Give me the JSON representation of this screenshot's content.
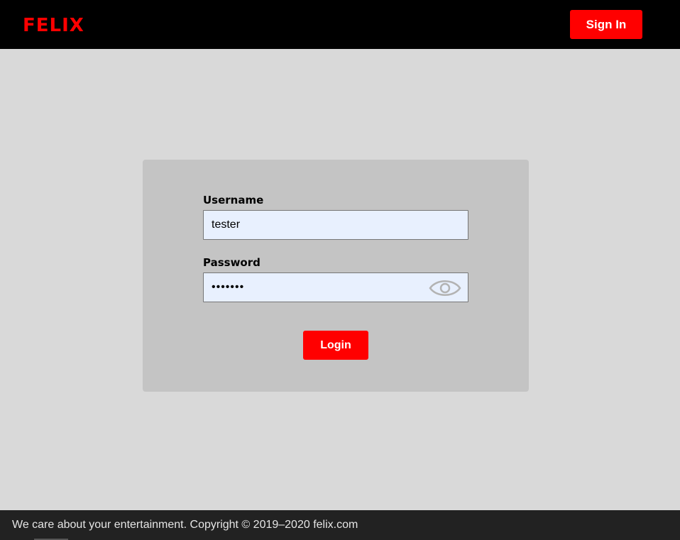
{
  "header": {
    "logo": "FELIX",
    "signin_label": "Sign In"
  },
  "login_form": {
    "username_label": "Username",
    "username_value": "tester",
    "password_label": "Password",
    "password_value": "tester1",
    "show_password_icon": "eye-icon",
    "login_label": "Login"
  },
  "footer": {
    "text": "We care about your entertainment. Copyright © 2019–2020 felix.com"
  },
  "colors": {
    "brand": "#ff0000",
    "header_bg": "#000000",
    "page_bg": "#d9d9d9",
    "card_bg": "#c4c4c4",
    "input_bg": "#e8f0fe",
    "footer_bg": "#222222"
  }
}
